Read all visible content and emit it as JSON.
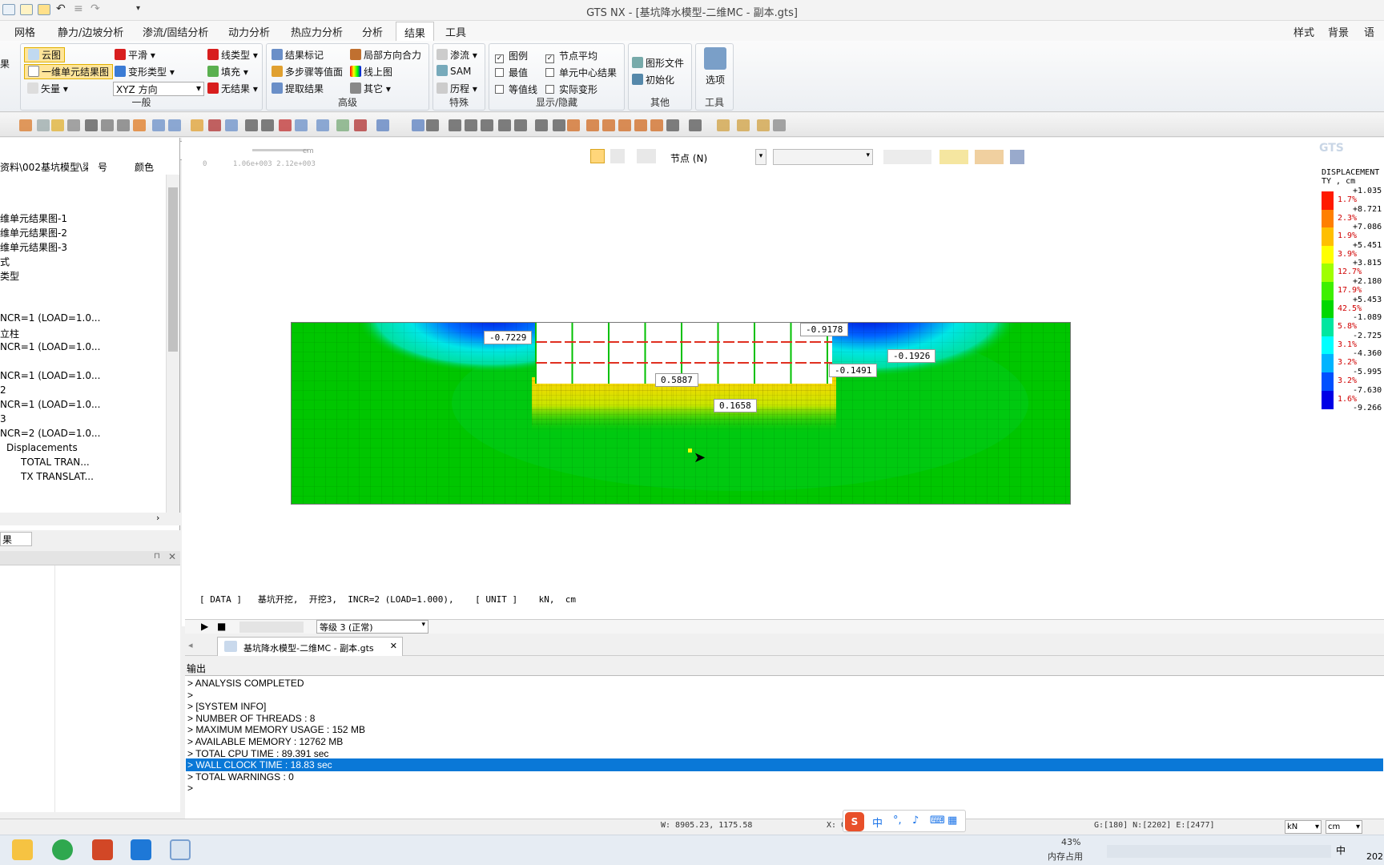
{
  "window": {
    "title": "GTS NX - [基坑降水模型-二维MC - 副本.gts]"
  },
  "menu": {
    "items": [
      "网格",
      "静力/边坡分析",
      "渗流/固结分析",
      "动力分析",
      "热应力分析",
      "分析",
      "结果",
      "工具"
    ],
    "active": "结果",
    "right": [
      "样式",
      "背景",
      "语言"
    ]
  },
  "ribbon": {
    "general": {
      "label": "一般",
      "cloud": "云图",
      "one_d": "一维单元结果图",
      "vector": "矢量",
      "smooth": "平滑",
      "deform": "变形类型",
      "xyz": "XYZ 方向",
      "linetype": "线类型",
      "fill": "填充",
      "noresult": "无结果"
    },
    "advanced": {
      "label": "高级",
      "mark": "结果标记",
      "multistep": "多步骤等值面",
      "extract": "提取结果",
      "localdir": "局部方向合力",
      "online": "线上图",
      "other": "其它"
    },
    "special": {
      "label": "特殊",
      "seepage": "渗流",
      "sam": "SAM",
      "history": "历程"
    },
    "display": {
      "label": "显示/隐藏",
      "legend": "图例",
      "maxval": "最值",
      "contour": "等值线",
      "nodeavg": "节点平均",
      "elemcenter": "单元中心结果",
      "realdeform": "实际变形"
    },
    "others": {
      "label": "其他",
      "imgfile": "图形文件",
      "init": "初始化"
    },
    "tools": {
      "label": "工具",
      "options": "选项"
    },
    "left_cut": "果"
  },
  "tree": {
    "header_no": "号",
    "header_color": "颜色",
    "rows": [
      "资料\\002基坑模型\\梁...",
      "",
      "维单元结果图-1",
      "维单元结果图-2",
      "维单元结果图-3",
      "式",
      "类型",
      "",
      "",
      "NCR=1 (LOAD=1.0...",
      "立柱",
      "NCR=1 (LOAD=1.0...",
      "",
      "NCR=1 (LOAD=1.0...",
      "2",
      "NCR=1 (LOAD=1.0...",
      "3",
      "NCR=2 (LOAD=1.0...",
      "Displacements",
      "TOTAL TRAN...",
      "TX TRANSLAT..."
    ],
    "bottom_label": "果"
  },
  "viewport": {
    "scale_ticks": "0      1.06e+003 2.12e+003",
    "scale_unit": "cm",
    "node_select": "节点 (N)",
    "data_line": "[ DATA ]   基坑开挖,  开挖3,  INCR=2 (LOAD=1.000),    [ UNIT ]    kN,  cm",
    "level": "等级 3 (正常)",
    "doc_tab": "基坑降水模型-二维MC - 副本.gts",
    "callouts": [
      "-0.7229",
      "-0.9178",
      "-0.1926",
      "-0.1491",
      "0.5887",
      "0.1658"
    ]
  },
  "legend": {
    "title1": "DISPLACEMENT",
    "title2": "TY , cm",
    "colors": [
      "#ff1a00",
      "#ff7f00",
      "#ffbf00",
      "#ffff00",
      "#a0ff00",
      "#3ef000",
      "#00d800",
      "#00e6a0",
      "#00ffff",
      "#00b4ff",
      "#0050ff",
      "#0000e6"
    ],
    "pcts": [
      "1.7%",
      "2.3%",
      "1.9%",
      "3.9%",
      "12.7%",
      "17.9%",
      "42.5%",
      "5.8%",
      "3.1%",
      "3.2%",
      "3.2%",
      "1.6%"
    ],
    "values": [
      "+1.035",
      "+8.721",
      "+7.086",
      "+5.451",
      "+3.815",
      "+2.180",
      "+5.453",
      "-1.089",
      "-2.725",
      "-4.360",
      "-5.995",
      "-7.630",
      "-9.266"
    ],
    "logo": "GTS"
  },
  "output": {
    "title": "输出",
    "lines": [
      "> ANALYSIS COMPLETED",
      ">",
      "> [SYSTEM INFO]",
      "> NUMBER OF THREADS    : 8",
      "> MAXIMUM MEMORY USAGE : 152 MB",
      "> AVAILABLE MEMORY     : 12762 MB",
      "> TOTAL CPU TIME       : 89.391 sec",
      "> WALL CLOCK TIME      : 18.83 sec",
      "> TOTAL WARNINGS : 0",
      ">"
    ],
    "highlight_index": 7
  },
  "status": {
    "coords": "W: 8905.23, 1175.58",
    "x": "X: 0",
    "counts": "G:[180] N:[2202] E:[2477]",
    "unit1": "kN",
    "unit2": "cm",
    "ime": "中"
  },
  "taskbar": {
    "mem_pct": "43%",
    "mem_label": "内存占用",
    "lang": "中",
    "year": "202"
  }
}
